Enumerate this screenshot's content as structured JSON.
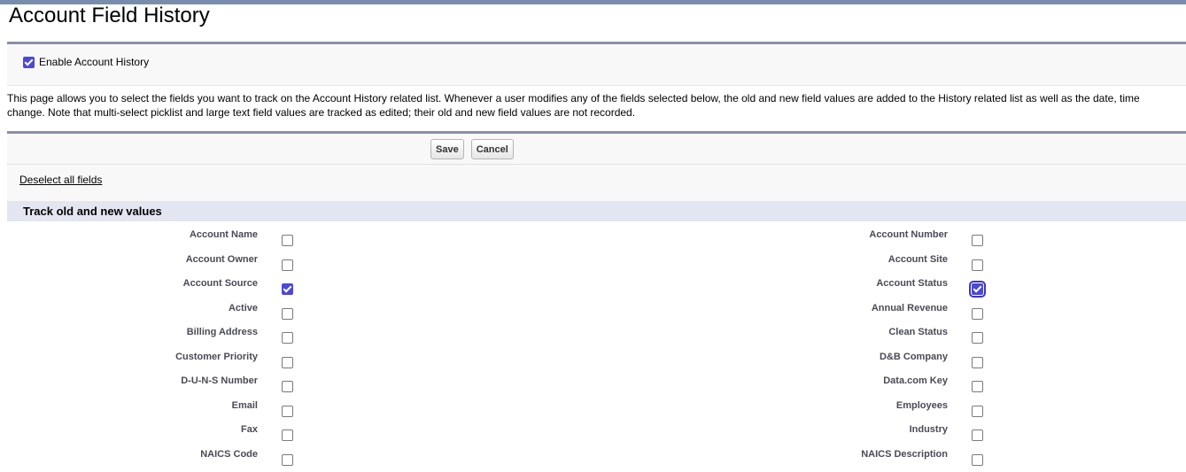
{
  "page": {
    "title": "Account Field History"
  },
  "enable": {
    "label": "Enable Account History",
    "checked": true
  },
  "description": "This page allows you to select the fields you want to track on the Account History related list. Whenever a user modifies any of the fields selected below, the old and new field values are added to the History related list as well as the date, time\nchange. Note that multi-select picklist and large text field values are tracked as edited; their old and new field values are not recorded.",
  "buttons": {
    "save": "Save",
    "cancel": "Cancel"
  },
  "deselect_label": "Deselect all fields",
  "section": {
    "title": "Track old and new values"
  },
  "fields": [
    {
      "left": {
        "label": "Account Name",
        "checked": false
      },
      "right": {
        "label": "Account Number",
        "checked": false
      }
    },
    {
      "left": {
        "label": "Account Owner",
        "checked": false
      },
      "right": {
        "label": "Account Site",
        "checked": false
      }
    },
    {
      "left": {
        "label": "Account Source",
        "checked": true
      },
      "right": {
        "label": "Account Status",
        "checked": true,
        "focused": true
      }
    },
    {
      "left": {
        "label": "Active",
        "checked": false
      },
      "right": {
        "label": "Annual Revenue",
        "checked": false
      }
    },
    {
      "left": {
        "label": "Billing Address",
        "checked": false
      },
      "right": {
        "label": "Clean Status",
        "checked": false
      }
    },
    {
      "left": {
        "label": "Customer Priority",
        "checked": false
      },
      "right": {
        "label": "D&B Company",
        "checked": false
      }
    },
    {
      "left": {
        "label": "D-U-N-S Number",
        "checked": false
      },
      "right": {
        "label": "Data.com Key",
        "checked": false
      }
    },
    {
      "left": {
        "label": "Email",
        "checked": false
      },
      "right": {
        "label": "Employees",
        "checked": false
      }
    },
    {
      "left": {
        "label": "Fax",
        "checked": false
      },
      "right": {
        "label": "Industry",
        "checked": false
      }
    },
    {
      "left": {
        "label": "NAICS Code",
        "checked": false
      },
      "right": {
        "label": "NAICS Description",
        "checked": false
      }
    }
  ],
  "colors": {
    "accent": "#4b49d6",
    "section_bg": "#e3e6f0",
    "border": "#8a8fa8"
  }
}
